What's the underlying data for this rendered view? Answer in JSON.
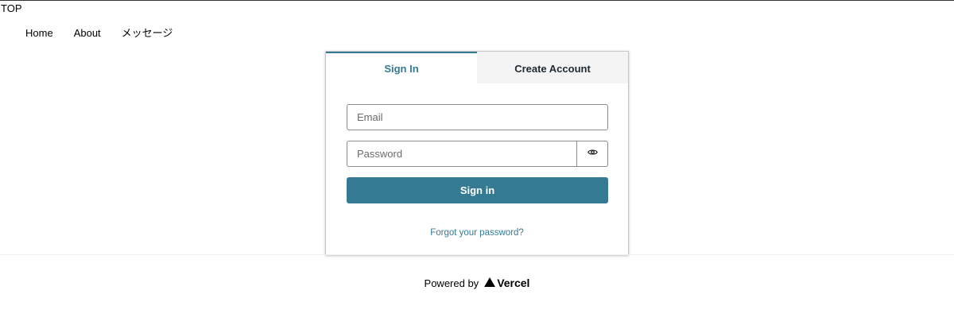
{
  "header": {
    "title": "TOP",
    "nav": [
      "Home",
      "About",
      "メッセージ"
    ]
  },
  "auth": {
    "tabs": [
      {
        "label": "Sign In",
        "active": true
      },
      {
        "label": "Create Account",
        "active": false
      }
    ],
    "email": {
      "placeholder": "Email",
      "value": ""
    },
    "password": {
      "placeholder": "Password",
      "value": ""
    },
    "show_password_icon": "eye-icon",
    "submit_label": "Sign in",
    "forgot_label": "Forgot your password?",
    "accent_color": "#357a93"
  },
  "footer": {
    "powered_by": "Powered by",
    "brand": "Vercel",
    "brand_icon": "triangle-icon"
  }
}
